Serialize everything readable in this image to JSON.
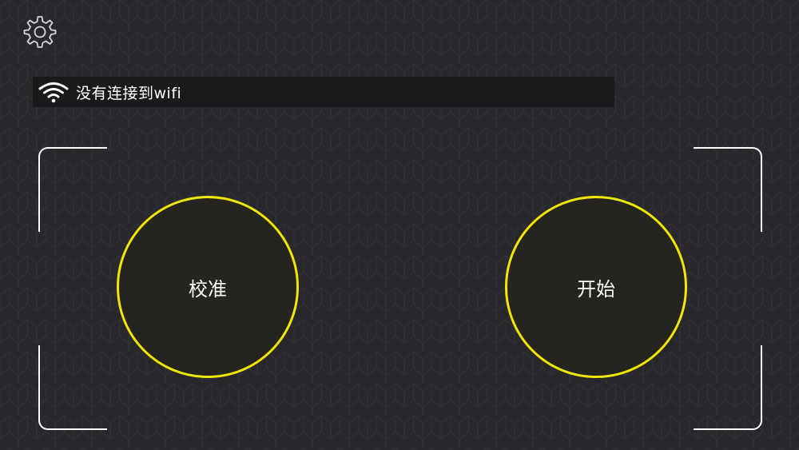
{
  "status": {
    "wifi_text": "没有连接到wifi"
  },
  "buttons": {
    "calibrate_label": "校准",
    "start_label": "开始"
  },
  "icons": {
    "settings": "gear-icon",
    "wifi": "wifi-icon"
  },
  "colors": {
    "background": "#27272c",
    "accent": "#f2e600",
    "status_bar": "#1a1a1d",
    "text": "#ffffff"
  }
}
